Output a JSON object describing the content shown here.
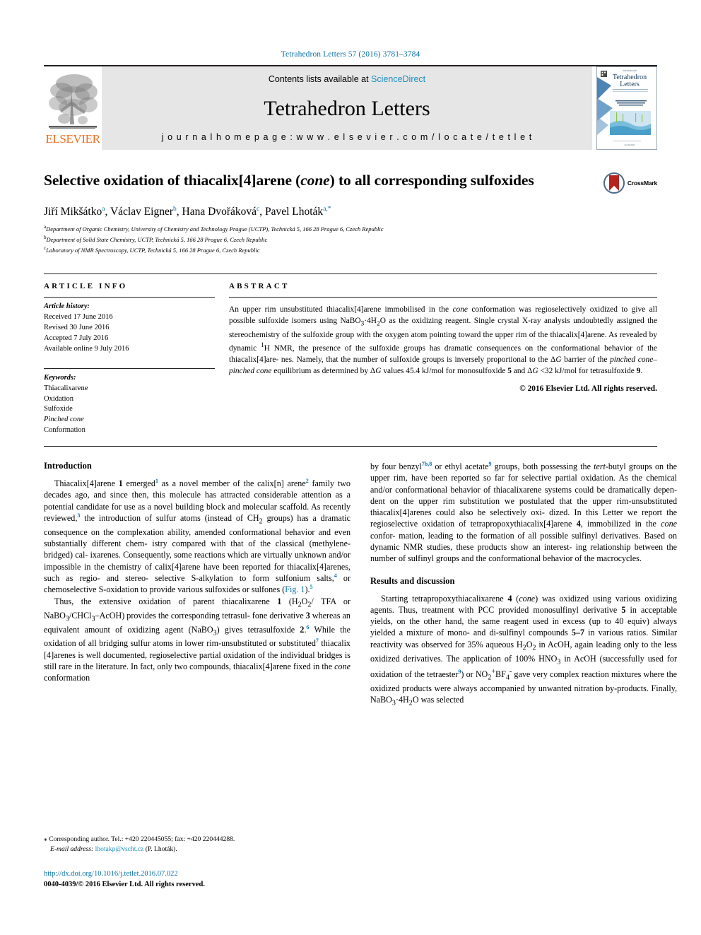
{
  "running_head": "Tetrahedron Letters 57 (2016) 3781–3784",
  "masthead": {
    "contents_prefix": "Contents lists available at ",
    "sciencedirect": "ScienceDirect",
    "journal_title": "Tetrahedron Letters",
    "homepage": "j o u r n a l   h o m e p a g e :   w w w . e l s e v i e r . c o m / l o c a t e / t e t l e t",
    "elsevier_word": "ELSEVIER",
    "cover_title_line1": "Tetrahedron",
    "cover_title_line2": "Letters",
    "accent_blue": "#1a8fc1",
    "elsevier_orange": "#f06f1e",
    "masthead_grey": "#e6e6e6"
  },
  "title": {
    "part1": "Selective oxidation of thiacalix[4]arene (",
    "italic": "cone",
    "part2": ") to all corresponding sulfoxides",
    "crossmark_label": "CrossMark"
  },
  "authors": {
    "list": [
      {
        "name": "Jiří Mikšátko",
        "sup": "a"
      },
      {
        "name": "Václav Eigner",
        "sup": "b"
      },
      {
        "name": "Hana Dvořáková",
        "sup": "c"
      },
      {
        "name": "Pavel Lhoták",
        "sup": "a,*"
      }
    ],
    "affiliations": [
      {
        "mark": "a",
        "text": "Department of Organic Chemistry, University of Chemistry and Technology Prague (UCTP), Technická 5, 166 28 Prague 6, Czech Republic"
      },
      {
        "mark": "b",
        "text": "Department of Solid State Chemistry, UCTP, Technická 5, 166 28 Prague 6, Czech Republic"
      },
      {
        "mark": "c",
        "text": "Laboratory of NMR Spectroscopy, UCTP, Technická 5, 166 28 Prague 6, Czech Republic"
      }
    ]
  },
  "article_info": {
    "heading": "ARTICLE INFO",
    "history_label": "Article history:",
    "history": [
      "Received 17 June 2016",
      "Revised 30 June 2016",
      "Accepted 7 July 2016",
      "Available online 9 July 2016"
    ],
    "keywords_label": "Keywords:",
    "keywords": [
      {
        "text": "Thiacalixarene",
        "italic": false
      },
      {
        "text": "Oxidation",
        "italic": false
      },
      {
        "text": "Sulfoxide",
        "italic": false
      },
      {
        "text": "Pinched cone",
        "italic": true
      },
      {
        "text": "Conformation",
        "italic": false
      }
    ]
  },
  "abstract": {
    "heading": "ABSTRACT",
    "copyright": "© 2016 Elsevier Ltd. All rights reserved."
  },
  "body": {
    "intro_heading": "Introduction",
    "results_heading": "Results and discussion"
  },
  "footnote": {
    "star": "⁎",
    "corresponding": "Corresponding author. Tel.: +420 220445055; fax: +420 220444288.",
    "email_label": "E-mail address:",
    "email": "lhotakp@vscht.cz",
    "email_suffix": "(P. Lhoták)."
  },
  "doi_block": {
    "doi": "http://dx.doi.org/10.1016/j.tetlet.2016.07.022",
    "issn": "0040-4039/© 2016 Elsevier Ltd. All rights reserved."
  }
}
